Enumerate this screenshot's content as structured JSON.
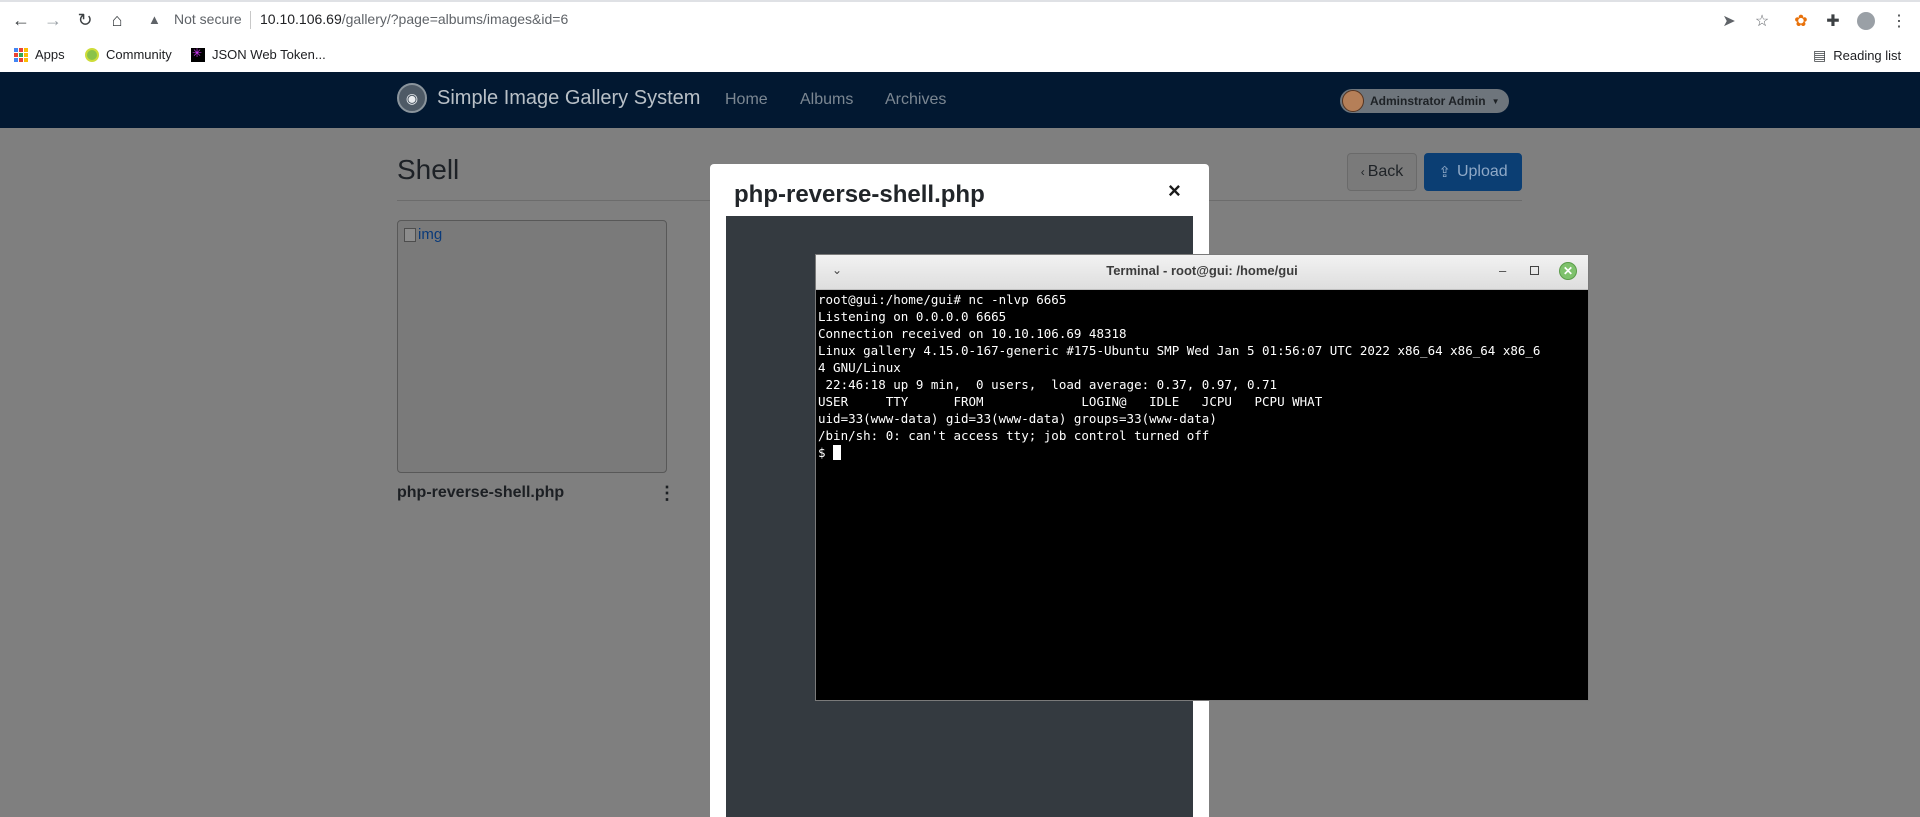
{
  "browser": {
    "security_label": "Not secure",
    "url_host": "10.10.106.69",
    "url_path": "/gallery/?page=albums/images&id=6",
    "bookmarks": [
      {
        "label": "Apps",
        "icon": "apps-grid-icon"
      },
      {
        "label": "Community",
        "icon": "community-favicon-icon"
      },
      {
        "label": "JSON Web Token...",
        "icon": "jwt-favicon-icon"
      }
    ],
    "reading_list": "Reading list"
  },
  "app": {
    "brand": "Simple Image Gallery System",
    "nav": [
      "Home",
      "Albums",
      "Archives"
    ],
    "user_name": "Adminstrator Admin"
  },
  "page": {
    "title": "Shell",
    "back_label": "Back",
    "upload_label": "Upload",
    "card": {
      "img_alt": "img",
      "filename": "php-reverse-shell.php"
    }
  },
  "modal": {
    "title": "php-reverse-shell.php",
    "close": "×"
  },
  "terminal": {
    "title": "Terminal - root@gui: /home/gui",
    "lines": [
      "root@gui:/home/gui# nc -nlvp 6665",
      "Listening on 0.0.0.0 6665",
      "Connection received on 10.10.106.69 48318",
      "Linux gallery 4.15.0-167-generic #175-Ubuntu SMP Wed Jan 5 01:56:07 UTC 2022 x86_64 x86_64 x86_6",
      "4 GNU/Linux",
      " 22:46:18 up 9 min,  0 users,  load average: 0.37, 0.97, 0.71",
      "USER     TTY      FROM             LOGIN@   IDLE   JCPU   PCPU WHAT",
      "uid=33(www-data) gid=33(www-data) groups=33(www-data)",
      "/bin/sh: 0: can't access tty; job control turned off"
    ],
    "prompt": "$ "
  },
  "colors": {
    "navbar": "#021831",
    "overlay_gray": "#7f7f7f",
    "modal_body": "#343a40",
    "upload_button": "#0b3e73",
    "terminal_bg": "#000000"
  }
}
